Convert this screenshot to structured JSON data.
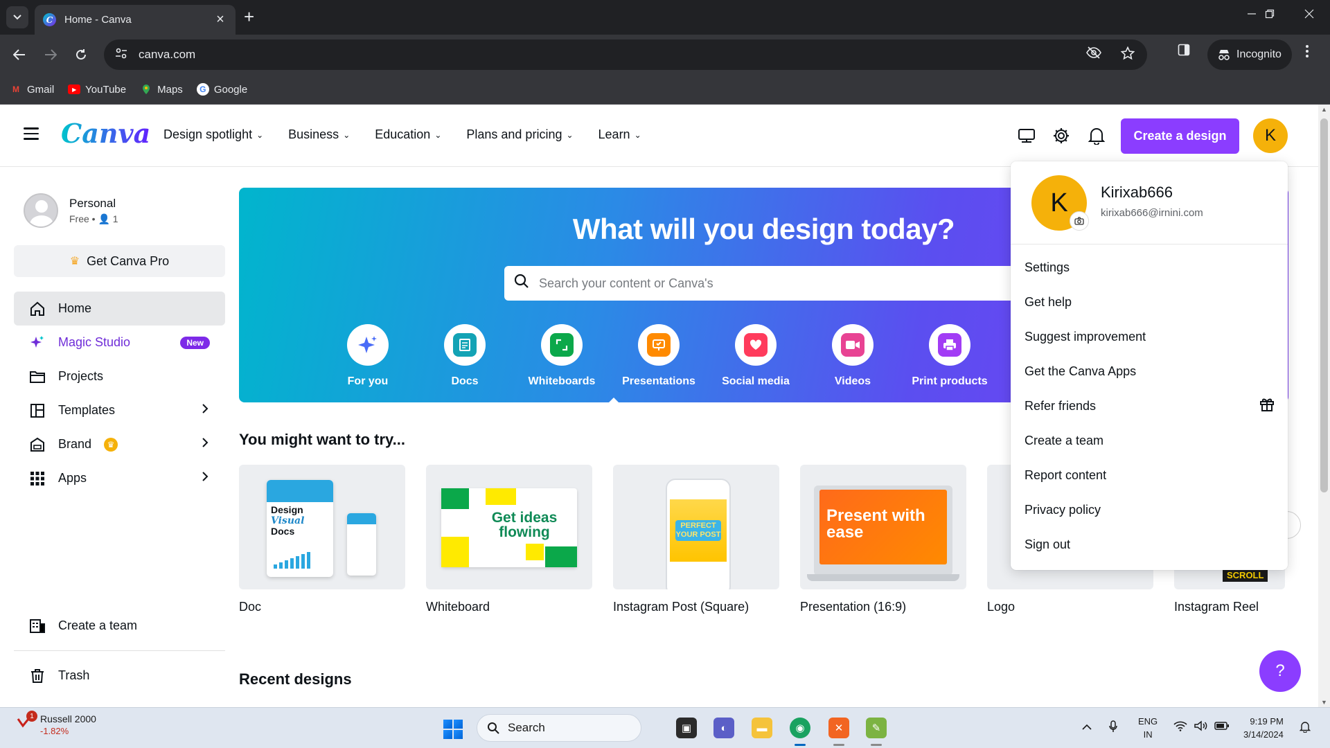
{
  "browser": {
    "tab_title": "Home - Canva",
    "tab_close": "×",
    "new_tab": "+",
    "url": "canva.com",
    "incognito_label": "Incognito",
    "bookmarks": [
      {
        "label": "Gmail",
        "icon": "gmail-icon",
        "color": "#ea4335"
      },
      {
        "label": "YouTube",
        "icon": "youtube-icon",
        "color": "#ff0000"
      },
      {
        "label": "Maps",
        "icon": "maps-icon",
        "color": "#34a853"
      },
      {
        "label": "Google",
        "icon": "google-icon",
        "color": "#4285f4"
      }
    ]
  },
  "header": {
    "logo": "Canva",
    "nav": [
      {
        "label": "Design spotlight"
      },
      {
        "label": "Business"
      },
      {
        "label": "Education"
      },
      {
        "label": "Plans and pricing"
      },
      {
        "label": "Learn"
      }
    ],
    "create_button": "Create a design",
    "avatar_letter": "K",
    "accent": "#8b3dff"
  },
  "sidebar": {
    "account_name": "Personal",
    "account_sub": "Free • 👤 1",
    "get_pro": "Get Canva Pro",
    "items": [
      {
        "label": "Home",
        "icon": "home-icon"
      },
      {
        "label": "Magic Studio",
        "icon": "sparkle-icon",
        "badge": "New"
      },
      {
        "label": "Projects",
        "icon": "folder-icon"
      },
      {
        "label": "Templates",
        "icon": "templates-icon"
      },
      {
        "label": "Brand",
        "icon": "brand-icon"
      },
      {
        "label": "Apps",
        "icon": "apps-icon"
      },
      {
        "label": "Create a team",
        "icon": "team-icon"
      },
      {
        "label": "Trash",
        "icon": "trash-icon"
      }
    ]
  },
  "hero": {
    "title": "What will you design today?",
    "search_placeholder": "Search your content or Canva's",
    "categories": [
      {
        "label": "For you",
        "icon": "sparkle-icon",
        "color": "#4a6cf7"
      },
      {
        "label": "Docs",
        "icon": "docs-icon",
        "color": "#13a3b5"
      },
      {
        "label": "Whiteboards",
        "icon": "whiteboard-icon",
        "color": "#0ba84a"
      },
      {
        "label": "Presentations",
        "icon": "presentation-icon",
        "color": "#ff8a00"
      },
      {
        "label": "Social media",
        "icon": "heart-icon",
        "color": "#ff3b5c"
      },
      {
        "label": "Videos",
        "icon": "video-icon",
        "color": "#e84393"
      },
      {
        "label": "Print products",
        "icon": "print-icon",
        "color": "#a23cf5"
      }
    ]
  },
  "try_section": {
    "title": "You might want to try...",
    "cards": [
      {
        "caption": "Doc",
        "art_title": "Design",
        "art_sub": "Visual",
        "art_tail": "Docs"
      },
      {
        "caption": "Whiteboard",
        "art_title": "Get ideas flowing"
      },
      {
        "caption": "Instagram Post (Square)",
        "art_title": "PERFECT YOUR POST"
      },
      {
        "caption": "Presentation (16:9)",
        "art_title": "Present with ease"
      },
      {
        "caption": "Logo"
      },
      {
        "caption": "Instagram Reel",
        "art_title": "SCROLL"
      }
    ]
  },
  "recent": {
    "title": "Recent designs"
  },
  "account_menu": {
    "username": "Kirixab666",
    "email": "kirixab666@irnini.com",
    "avatar_letter": "K",
    "items": [
      {
        "label": "Settings"
      },
      {
        "label": "Get help"
      },
      {
        "label": "Suggest improvement"
      },
      {
        "label": "Get the Canva Apps"
      },
      {
        "label": "Refer friends",
        "icon": "gift-icon"
      },
      {
        "label": "Create a team"
      },
      {
        "label": "Report content"
      },
      {
        "label": "Privacy policy"
      },
      {
        "label": "Sign out"
      }
    ]
  },
  "help_button": "?",
  "taskbar": {
    "stock_name": "Russell 2000",
    "stock_change": "-1.82%",
    "stock_badge": "1",
    "search_label": "Search",
    "lang_1": "ENG",
    "lang_2": "IN",
    "time": "9:19 PM",
    "date": "3/14/2024"
  }
}
